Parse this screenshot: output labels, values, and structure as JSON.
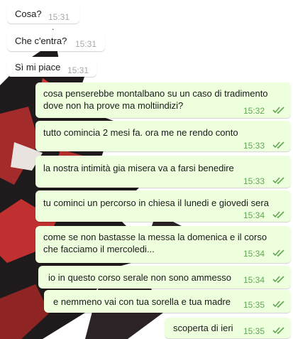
{
  "conversation": {
    "incoming": [
      {
        "text": "Cosa?",
        "time": "15:31"
      },
      {
        "text": "Che c'entra?",
        "time": "15:31"
      },
      {
        "text": "Sì mi piace",
        "time": "15:31"
      }
    ],
    "outgoing": [
      {
        "line1": "cosa penserebbe montalbano su un caso di tradimento",
        "line2": "dove non ha prove ma moltiindizi?",
        "time": "15:32",
        "status": "read"
      },
      {
        "text": "tutto comincia 2 mesi fa. ora me ne rendo conto",
        "time": "15:33",
        "status": "read"
      },
      {
        "text": "la nostra intimità gia misera va a farsi benedire",
        "time": "15:33",
        "status": "read"
      },
      {
        "text": "tu cominci un percorso in chiesa il lunedi e giovedi sera",
        "time": "15:34",
        "status": "read"
      },
      {
        "line1": "come se non bastasse la messa la domenica e il corso",
        "line2": "che facciamo il mercoledi...",
        "time": "15:34",
        "status": "read"
      },
      {
        "text": "io in questo corso serale non sono ammesso",
        "time": "15:34",
        "status": "read"
      },
      {
        "text": "e nemmeno vai con tua sorella e tua madre",
        "time": "15:35",
        "status": "read"
      },
      {
        "text": "scoperta di ieri",
        "time": "15:35",
        "status": "read"
      }
    ]
  },
  "colors": {
    "incoming_bubble": "#ffffff",
    "outgoing_bubble": "#eeffde",
    "outgoing_time": "#5fa850",
    "read_ticks": "#5fa850",
    "incoming_time": "#a8a8a8"
  },
  "icons": {
    "read_status": "double-check-icon",
    "wallpaper": "anime-character-wallpaper"
  }
}
